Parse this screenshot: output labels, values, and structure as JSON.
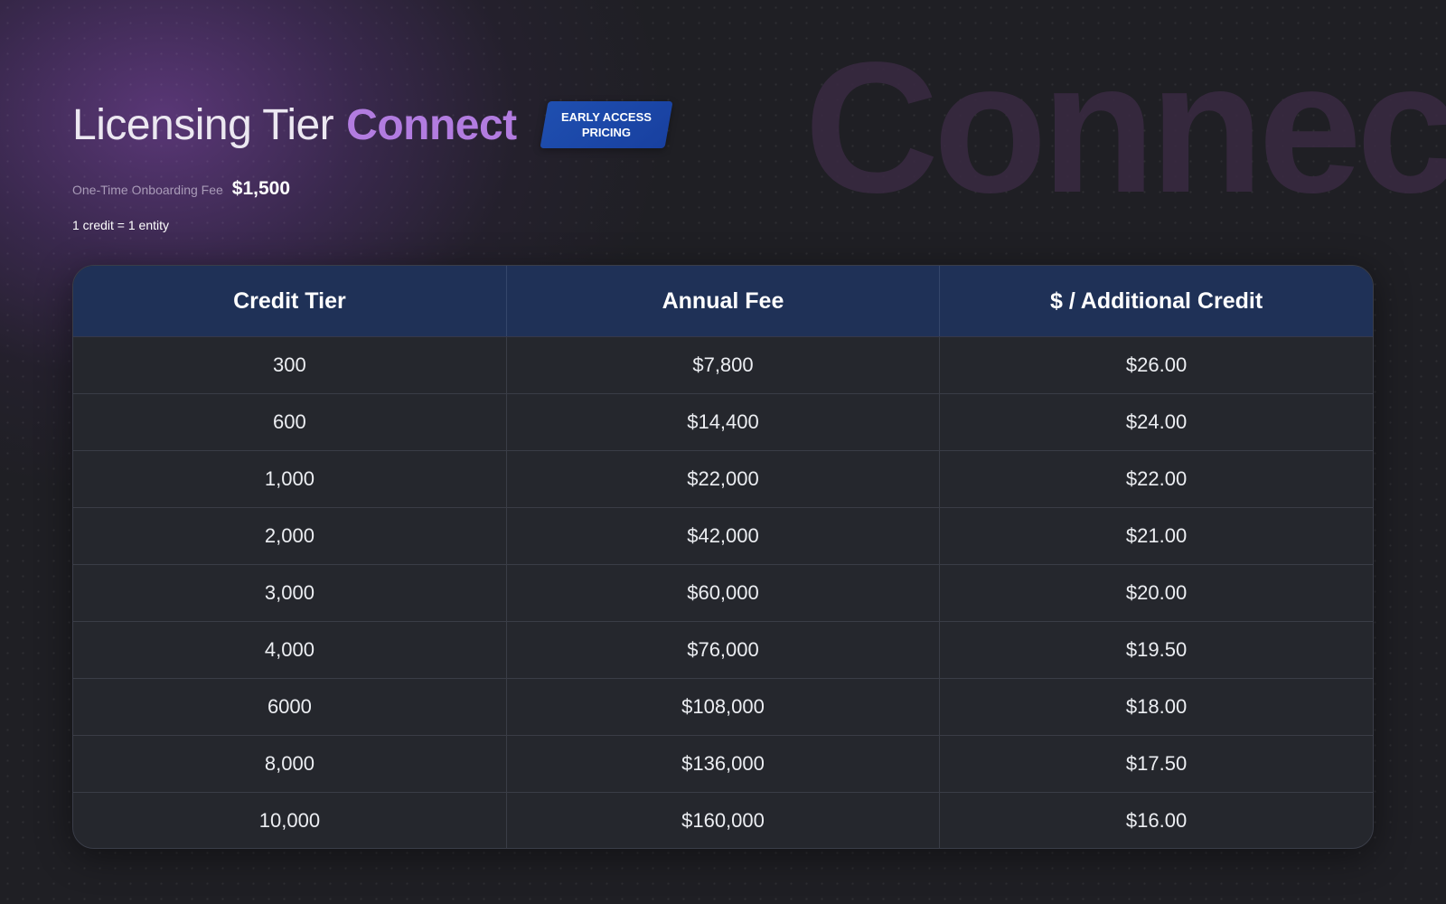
{
  "watermark": {
    "text": "Connec"
  },
  "header": {
    "title_main": "Licensing Tier",
    "title_accent": "Connect",
    "badge": {
      "line1": "Early Access",
      "line2": "Pricing"
    }
  },
  "fees": {
    "onboarding_label": "One-Time Onboarding Fee",
    "onboarding_value": "$1,500",
    "credit_note": "1 credit = 1 entity"
  },
  "table": {
    "headers": [
      "Credit Tier",
      "Annual Fee",
      "$ / Additional Credit"
    ],
    "rows": [
      [
        "300",
        "$7,800",
        "$26.00"
      ],
      [
        "600",
        "$14,400",
        "$24.00"
      ],
      [
        "1,000",
        "$22,000",
        "$22.00"
      ],
      [
        "2,000",
        "$42,000",
        "$21.00"
      ],
      [
        "3,000",
        "$60,000",
        "$20.00"
      ],
      [
        "4,000",
        "$76,000",
        "$19.50"
      ],
      [
        "6000",
        "$108,000",
        "$18.00"
      ],
      [
        "8,000",
        "$136,000",
        "$17.50"
      ],
      [
        "10,000",
        "$160,000",
        "$16.00"
      ]
    ]
  },
  "colors": {
    "background": "#1f1f24",
    "accent": "#b27ce0",
    "header_bg": "#1f3157",
    "badge_bg": "#1f4fb0"
  }
}
